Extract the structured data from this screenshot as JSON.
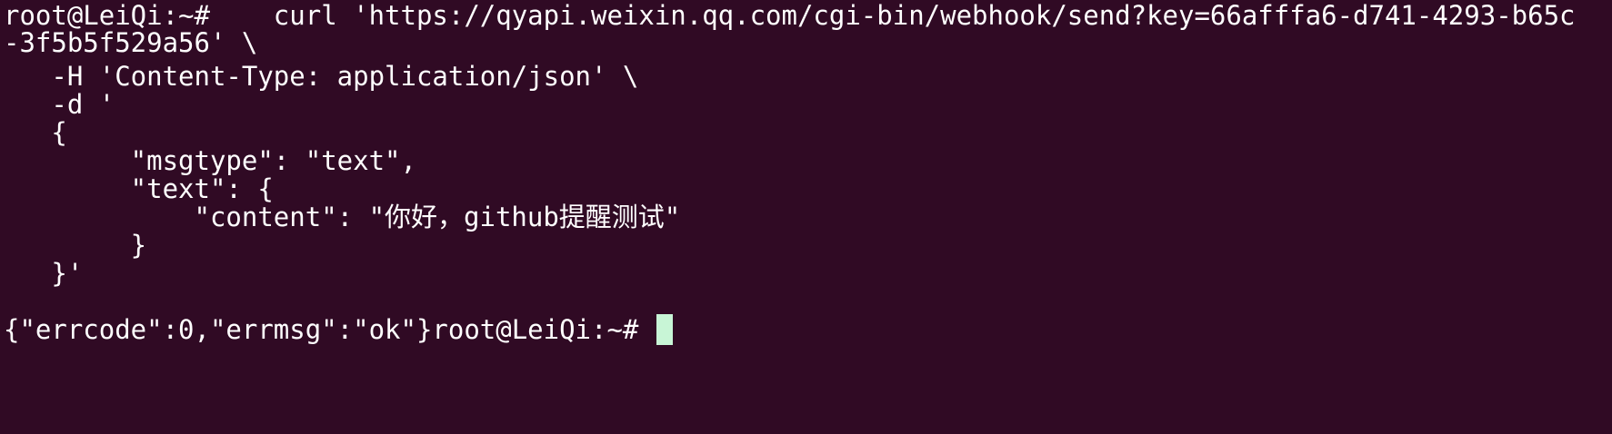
{
  "terminal": {
    "lines": [
      "root@LeiQi:~#    curl 'https://qyapi.weixin.qq.com/cgi-bin/webhook/send?key=66afffa6-d741-4293-b65c",
      "-3f5b5f529a56' \\",
      "   -H 'Content-Type: application/json' \\",
      "   -d '",
      "   {",
      "        \"msgtype\": \"text\",",
      "        \"text\": {",
      "            \"content\": \"你好，github提醒测试\"",
      "        }",
      "   }'",
      "",
      "{\"errcode\":0,\"errmsg\":\"ok\"}root@LeiQi:~# "
    ],
    "colors": {
      "background": "#300a24",
      "foreground": "#ffffff",
      "cursor": "#c8f5d6"
    }
  }
}
